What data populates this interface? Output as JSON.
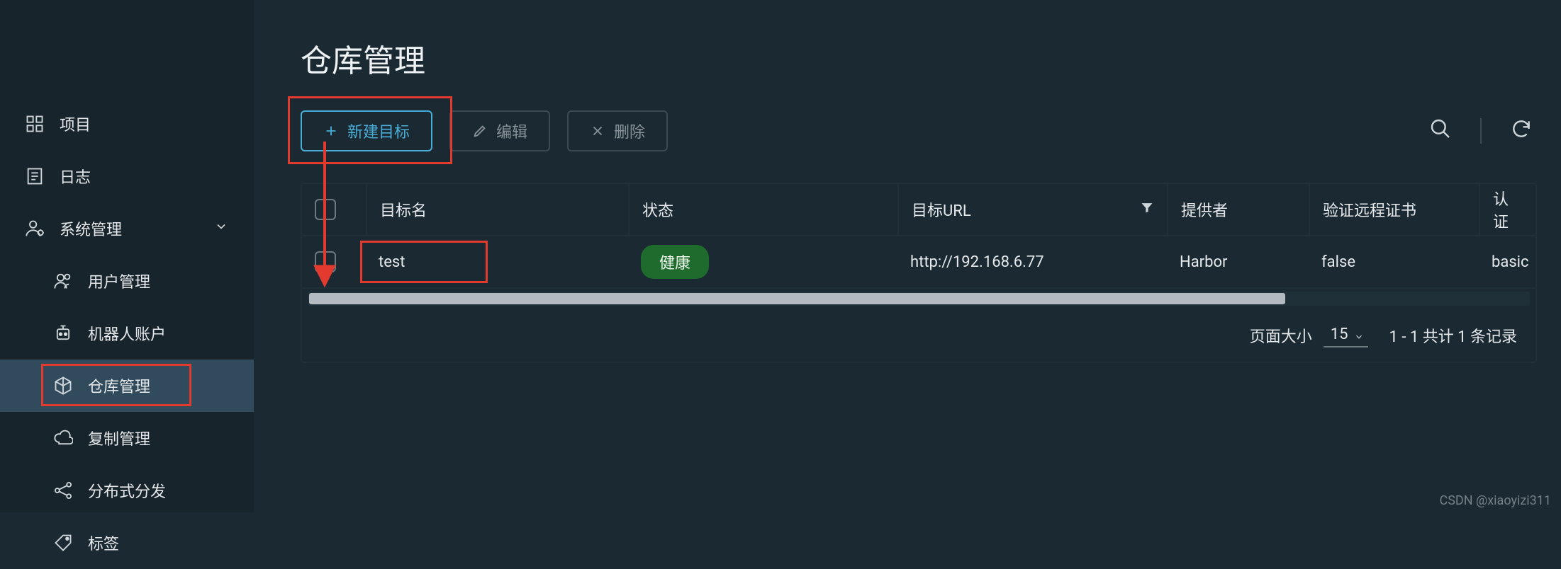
{
  "sidebar": {
    "items": [
      {
        "label": "项目"
      },
      {
        "label": "日志"
      },
      {
        "label": "系统管理"
      }
    ],
    "subitems": [
      {
        "label": "用户管理"
      },
      {
        "label": "机器人账户"
      },
      {
        "label": "仓库管理"
      },
      {
        "label": "复制管理"
      },
      {
        "label": "分布式分发"
      },
      {
        "label": "标签"
      }
    ]
  },
  "page": {
    "title": "仓库管理"
  },
  "toolbar": {
    "new_target": "新建目标",
    "edit": "编辑",
    "delete": "删除"
  },
  "table": {
    "headers": {
      "name": "目标名",
      "status": "状态",
      "url": "目标URL",
      "provider": "提供者",
      "verify_cert": "验证远程证书",
      "auth": "认证"
    },
    "rows": [
      {
        "name": "test",
        "status": "健康",
        "url": "http://192.168.6.77",
        "provider": "Harbor",
        "verify_cert": "false",
        "auth": "basic"
      }
    ],
    "footer": {
      "page_size_label": "页面大小",
      "page_size_value": "15",
      "records_text": "1 - 1 共计 1 条记录"
    }
  },
  "watermark": "CSDN @xiaoyizi311"
}
